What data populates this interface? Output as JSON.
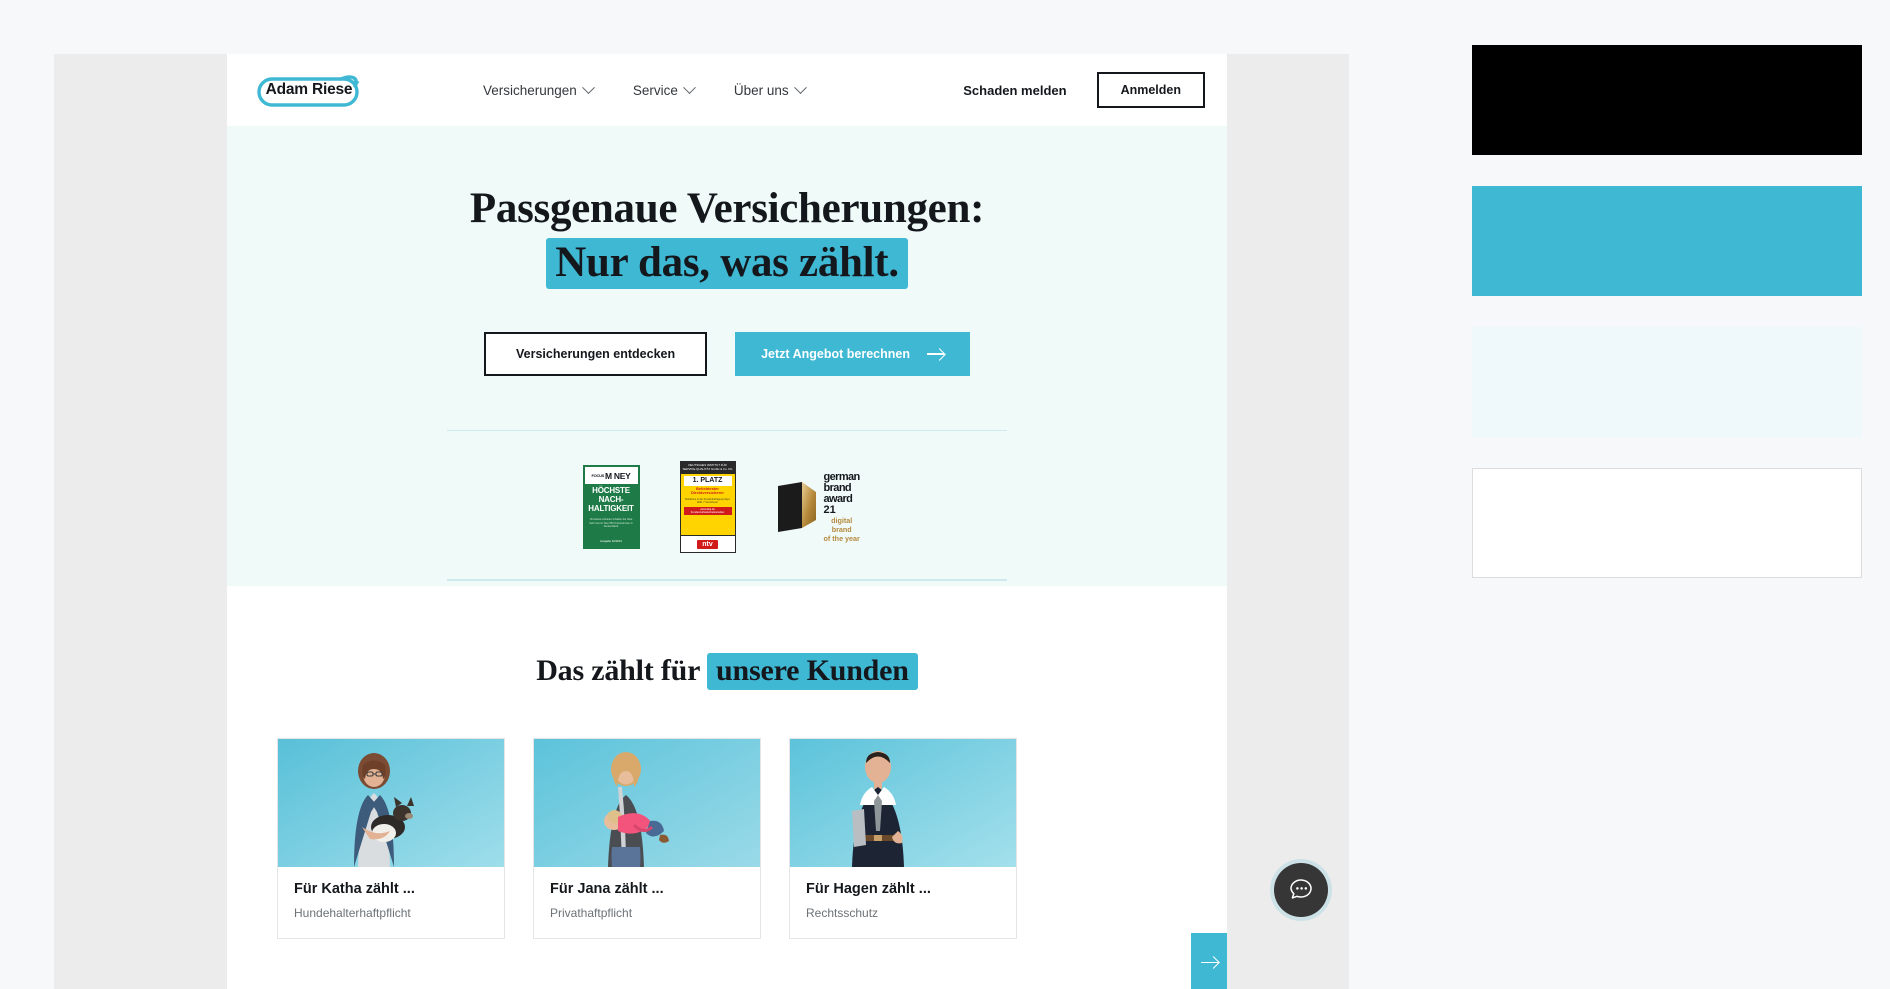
{
  "brand": {
    "logo_text": "Adam Riese",
    "accent_color": "#3fb8d4",
    "dark_color": "#14181c",
    "pale_color": "#eff8fb"
  },
  "header": {
    "nav": [
      {
        "label": "Versicherungen",
        "icon": "chevron-down-icon"
      },
      {
        "label": "Service",
        "icon": "chevron-down-icon"
      },
      {
        "label": "Über uns",
        "icon": "chevron-down-icon"
      }
    ],
    "claim_link": "Schaden melden",
    "login_button": "Anmelden"
  },
  "hero": {
    "headline_line1": "Passgenaue Versicherungen:",
    "headline_line2_highlight": "Nur das, was zählt.",
    "cta_secondary": "Versicherungen entdecken",
    "cta_primary": "Jetzt Angebot berechnen",
    "cta_primary_icon": "arrow-right-icon"
  },
  "awards": [
    {
      "name": "focus-money-award",
      "publisher": "FOCUS MONEY",
      "publisher_prefix": "FOCUS",
      "publisher_main": "M NEY",
      "title_line1": "HÖCHSTE",
      "title_line2": "NACH-",
      "title_line3": "HALTIGKEIT",
      "fine_print": "18 weitere Anbieter erhalten die Note Sehr Gut im Test 783 Unternehmen in Deutschland",
      "issue": "Ausgabe 42/2021"
    },
    {
      "name": "disq-award",
      "institute": "DEUTSCHES INSTITUT FÜR SERVICE-QUALITÄT GmbH & Co. KG",
      "place": "1. PLATZ",
      "category": "Beliebtester Direktversicherer",
      "fine_print": "Teilnahme in der Kundenbefragung Sept. 2021 7 Versicherer",
      "strip": "www.disq.de Kundenzufriedenheitsstudien",
      "media_partner": "ntv"
    },
    {
      "name": "german-brand-award",
      "line1": "german",
      "line2": "brand",
      "line3": "award",
      "year": "21",
      "subtitle_line1": "digital",
      "subtitle_line2": "brand",
      "subtitle_line3": "of the year"
    }
  ],
  "customers": {
    "title_plain": "Das zählt für ",
    "title_highlight": "unsere Kunden",
    "next_icon": "arrow-right-icon",
    "cards": [
      {
        "name": "Für Katha zählt ...",
        "product": "Hundehalterhaftpflicht",
        "photo": "woman-with-dog-photo"
      },
      {
        "name": "Für Jana zählt ...",
        "product": "Privathaftpflicht",
        "photo": "woman-with-baby-photo"
      },
      {
        "name": "Für Hagen zählt ...",
        "product": "Rechtsschutz",
        "photo": "man-in-suit-photo"
      }
    ]
  },
  "chat": {
    "icon": "chat-bubble-icon",
    "label": "Chat"
  },
  "palette": {
    "swatches": [
      {
        "name": "black",
        "hex": "#000000"
      },
      {
        "name": "teal",
        "hex": "#3fb8d4"
      },
      {
        "name": "pale-blue",
        "hex": "#eff8fb"
      },
      {
        "name": "white",
        "hex": "#ffffff"
      }
    ]
  }
}
